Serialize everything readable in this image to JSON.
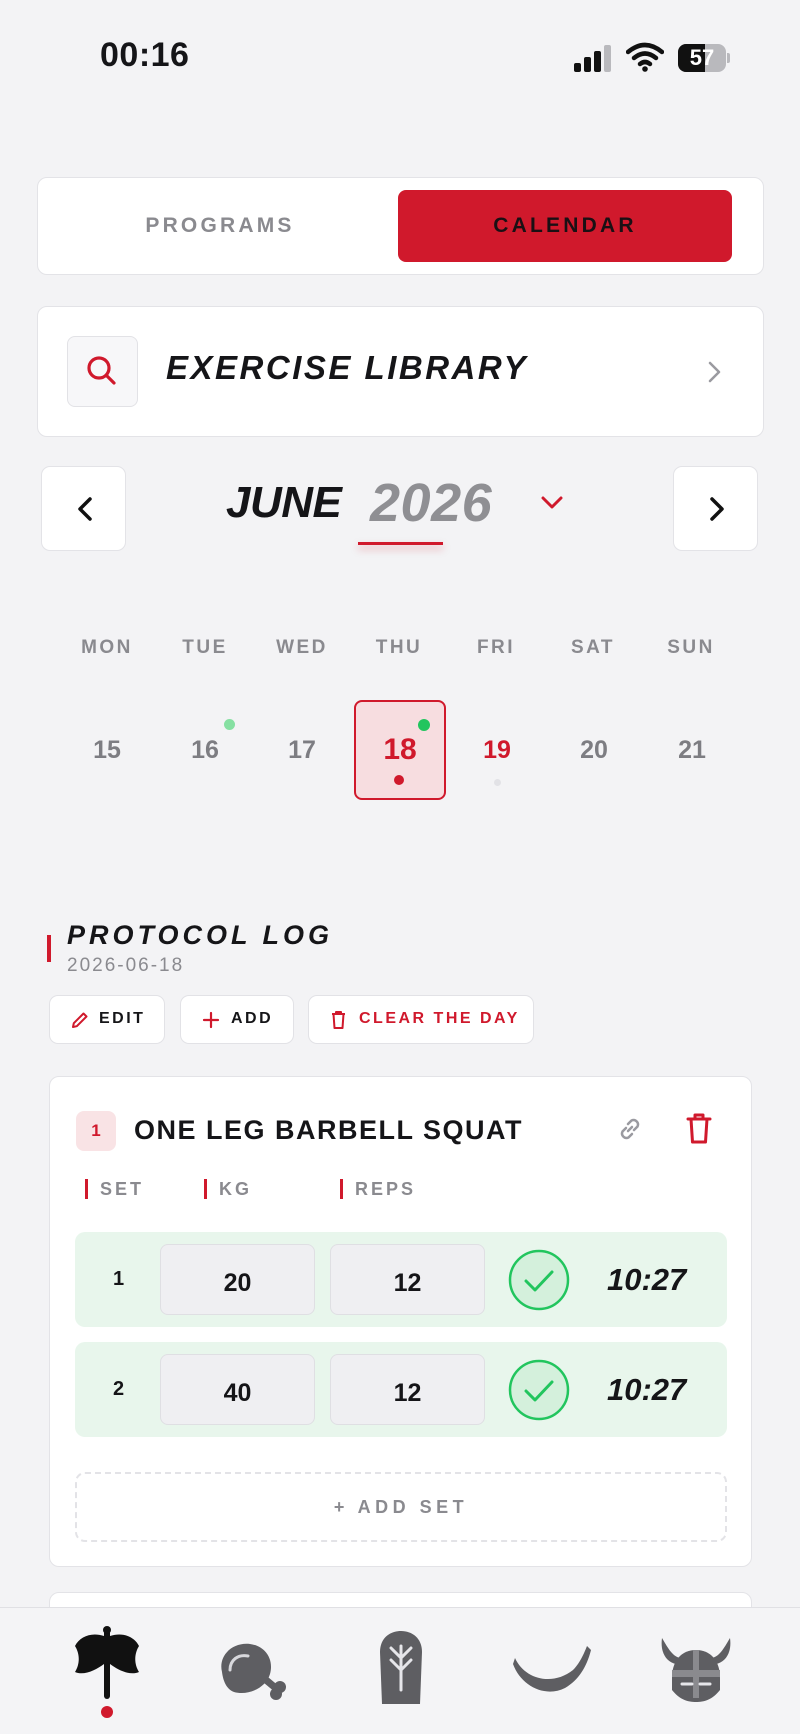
{
  "status_bar": {
    "time": "00:16",
    "battery": "57",
    "battery_level": 0.57
  },
  "segment": {
    "programs_label": "PROGRAMS",
    "calendar_label": "CALENDAR",
    "active": "CALENDAR"
  },
  "library": {
    "title": "EXERCISE LIBRARY"
  },
  "calendar": {
    "month": "JUNE",
    "year": "2026",
    "weekdays": [
      "MON",
      "TUE",
      "WED",
      "THU",
      "FRI",
      "SAT",
      "SUN"
    ],
    "days": [
      "15",
      "16",
      "17",
      "18",
      "19",
      "20",
      "21"
    ],
    "selected_day": "18",
    "today": "19"
  },
  "log": {
    "title": "PROTOCOL LOG",
    "date": "2026-06-18",
    "edit_label": "EDIT",
    "add_label": "ADD",
    "clear_label": "CLEAR THE DAY"
  },
  "exercise": {
    "index": "1",
    "name": "ONE LEG BARBELL SQUAT",
    "col_set": "SET",
    "col_kg": "KG",
    "col_reps": "REPS",
    "sets": [
      {
        "set": "1",
        "kg": "20",
        "reps": "12",
        "time": "10:27",
        "done": true
      },
      {
        "set": "2",
        "kg": "40",
        "reps": "12",
        "time": "10:27",
        "done": true
      }
    ],
    "add_set_label": "+ ADD SET"
  },
  "tabs": [
    "axe-icon",
    "meat-icon",
    "rune-stone-icon",
    "horn-icon",
    "viking-helmet-icon"
  ],
  "colors": {
    "accent": "#d0192c",
    "success": "#22c55e",
    "success_bg": "#e8f6ec"
  }
}
